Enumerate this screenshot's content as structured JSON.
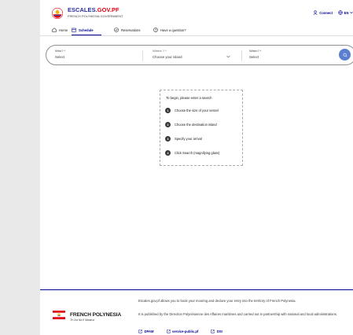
{
  "header": {
    "brand_part1": "ESCALES.",
    "brand_part2": "GOV.PF",
    "brand_sub": "FRENCH POLYNESIA GOVERNMENT",
    "connect_label": "Connect",
    "lang_label": "EN"
  },
  "nav": {
    "home": "Home",
    "schedule": "Schedule",
    "reservations": "Reservations",
    "question": "Have a question?"
  },
  "search": {
    "who_label": "Who? *",
    "who_value": "Select",
    "where_label": "Where ? *",
    "where_value": "Choose your island",
    "when_label": "When? *",
    "when_value": "Select"
  },
  "help": {
    "title": "To begin, please enter a search",
    "steps": [
      {
        "num": "1",
        "text": "Choose the size of your vessel"
      },
      {
        "num": "2",
        "text": "Choose the destination island"
      },
      {
        "num": "3",
        "text": "Specify your arrival"
      },
      {
        "num": "4",
        "text": "Click Search (magnifying glass)"
      }
    ]
  },
  "footer": {
    "name": "FRENCH POLYNESIA",
    "motto": "Te Ora Na E Manava",
    "text1": "Escales.gov.pf allows you to book your mooring and declare your entry into the territory of French Polynesia.",
    "text2": "It is published by the Direction Polynésienne des Affaires maritimes and carried out in partnership with national and local administrations.",
    "links": [
      "DPAM",
      "service-public.pf",
      "DSI"
    ]
  },
  "colors": {
    "brand_blue": "#000091",
    "accent_red": "#e1000f",
    "search_button": "#5a7fcf"
  }
}
